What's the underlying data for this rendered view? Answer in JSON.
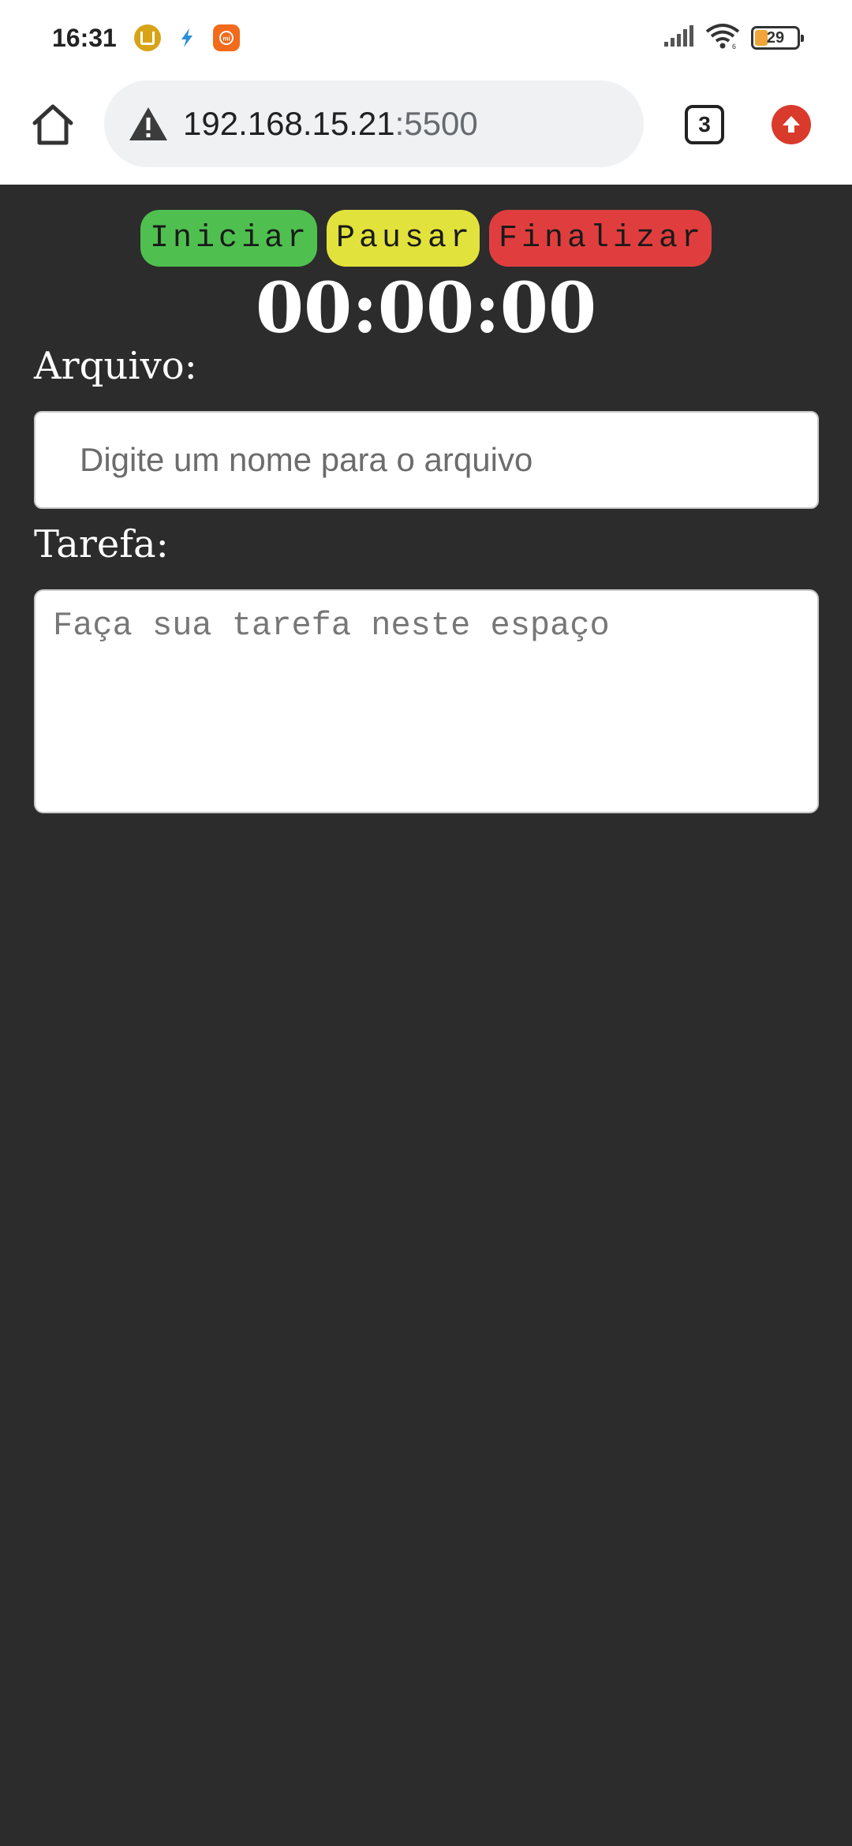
{
  "status_bar": {
    "time": "16:31",
    "battery": "29"
  },
  "browser": {
    "url_host": "192.168.15.21",
    "url_port": ":5500",
    "tab_count": "3"
  },
  "controls": {
    "start_label": "Iniciar",
    "pause_label": "Pausar",
    "finish_label": "Finalizar",
    "colors": {
      "start": "#4fc04f",
      "pause": "#e2e23c",
      "finish": "#e03e3e"
    }
  },
  "timer": {
    "value": "00:00:00"
  },
  "file": {
    "label": "Arquivo:",
    "placeholder": "Digite um nome para o arquivo",
    "value": ""
  },
  "task": {
    "label": "Tarefa:",
    "placeholder": "Faça sua tarefa neste espaço",
    "value": ""
  },
  "icons": {
    "home": "home-icon",
    "warning": "warning-icon",
    "tabs": "tabs-icon",
    "update": "update-arrow-icon"
  }
}
